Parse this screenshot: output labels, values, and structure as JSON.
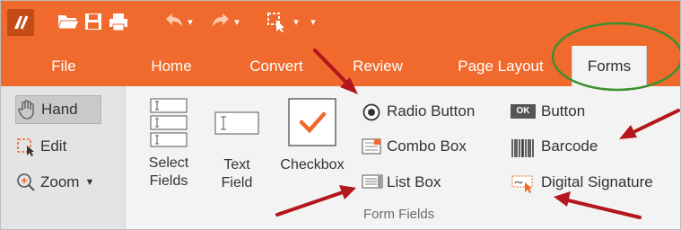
{
  "window": {
    "quick_access": {
      "logo": "app-logo-icon",
      "icons": [
        "open-folder-icon",
        "save-icon",
        "print-icon",
        "undo-icon",
        "redo-icon",
        "select-tool-icon"
      ],
      "customize": "customize-quick-access-icon"
    }
  },
  "tabs": [
    {
      "label": "File"
    },
    {
      "label": "Home"
    },
    {
      "label": "Convert"
    },
    {
      "label": "Review"
    },
    {
      "label": "Page Layout"
    },
    {
      "label": "Forms",
      "active": true
    }
  ],
  "left_tools": {
    "hand": "Hand",
    "edit": "Edit",
    "zoom": "Zoom"
  },
  "ribbon": {
    "select_fields": {
      "line1": "Select",
      "line2": "Fields"
    },
    "text_field": {
      "line1": "Text",
      "line2": "Field"
    },
    "checkbox": {
      "label": "Checkbox"
    },
    "radio_button": "Radio Button",
    "combo_box": "Combo Box",
    "list_box": "List Box",
    "button": "Button",
    "button_badge": "OK",
    "barcode": "Barcode",
    "digital_signature": "Digital Signature",
    "group_label": "Form Fields"
  },
  "colors": {
    "accent": "#ef6a2c",
    "ribbon_bg": "#f3f3f3",
    "annotation_arrow": "#b3161b",
    "annotation_circle": "#3f8f2f"
  }
}
